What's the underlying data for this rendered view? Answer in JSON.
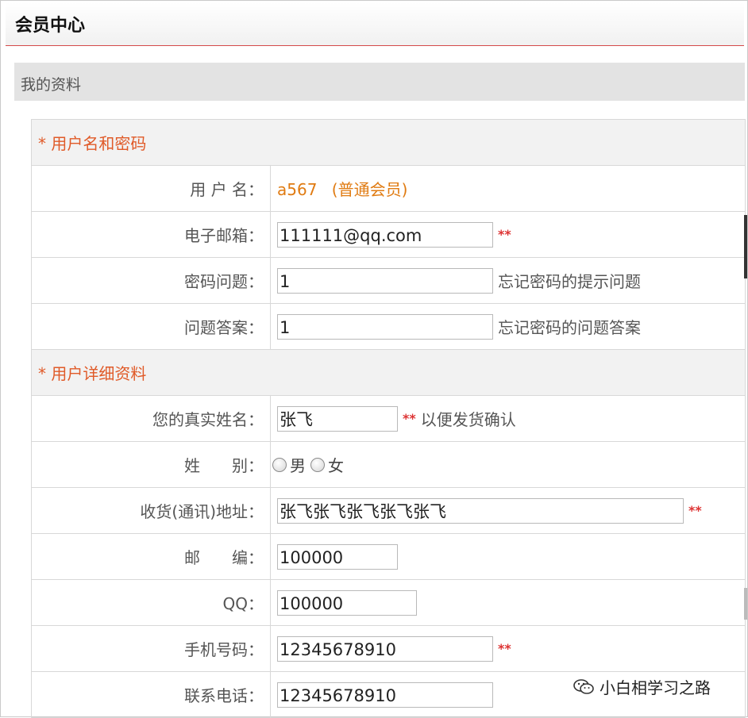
{
  "header": {
    "title": "会员中心"
  },
  "section": {
    "title": "我的资料"
  },
  "groups": {
    "account": "* 用户名和密码",
    "details": "* 用户详细资料"
  },
  "fields": {
    "username": {
      "label": "用 户 名：",
      "value": "a567",
      "member_level": "(普通会员)"
    },
    "email": {
      "label": "电子邮箱：",
      "value": "111111@qq.com",
      "required": "**"
    },
    "question": {
      "label": "密码问题：",
      "value": "1",
      "hint": "忘记密码的提示问题"
    },
    "answer": {
      "label": "问题答案：",
      "value": "1",
      "hint": "忘记密码的问题答案"
    },
    "realname": {
      "label": "您的真实姓名：",
      "value": "张飞",
      "required": "**",
      "hint": "以便发货确认"
    },
    "gender": {
      "label": "姓　　别：",
      "options": [
        "男",
        "女"
      ]
    },
    "address": {
      "label": "收货(通讯)地址：",
      "value": "张飞张飞张飞张飞张飞",
      "required": "**"
    },
    "postcode": {
      "label": "邮　　编：",
      "value": "100000"
    },
    "qq": {
      "label": "QQ：",
      "value": "100000"
    },
    "mobile": {
      "label": "手机号码：",
      "value": "12345678910",
      "required": "**"
    },
    "phone": {
      "label": "联系电话：",
      "value": "12345678910"
    }
  },
  "watermark": {
    "text": "小白相学习之路",
    "icon": "wechat-icon"
  },
  "colors": {
    "group_text": "#e05a28",
    "username": "#e07b12",
    "required": "#dd3333",
    "header_rule": "#d44a4a"
  }
}
